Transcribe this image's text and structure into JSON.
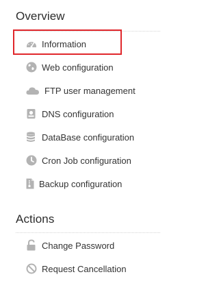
{
  "overview": {
    "title": "Overview",
    "items": [
      {
        "label": "Information",
        "icon": "dashboard-icon"
      },
      {
        "label": "Web configuration",
        "icon": "globe-icon"
      },
      {
        "label": "FTP user management",
        "icon": "cloud-icon"
      },
      {
        "label": "DNS configuration",
        "icon": "dns-icon"
      },
      {
        "label": "DataBase configuration",
        "icon": "database-icon"
      },
      {
        "label": "Cron Job configuration",
        "icon": "clock-icon"
      },
      {
        "label": "Backup configuration",
        "icon": "file-archive-icon"
      }
    ]
  },
  "actions": {
    "title": "Actions",
    "items": [
      {
        "label": "Change Password",
        "icon": "unlock-icon"
      },
      {
        "label": "Request Cancellation",
        "icon": "ban-icon"
      }
    ]
  },
  "colors": {
    "icon_gray": "#b3b3b3",
    "highlight": "#e0262b",
    "text": "#333333"
  }
}
